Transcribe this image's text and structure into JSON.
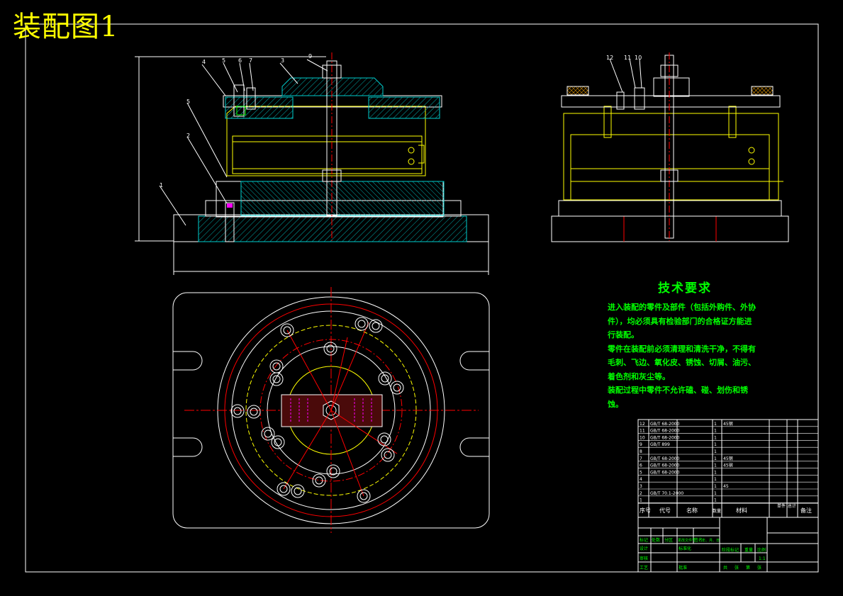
{
  "title": "装配图1",
  "tech_requirements": {
    "heading": "技术要求",
    "items": [
      "进入装配的零件及部件（包括外购件、外协件），均必须具有检验部门的合格证方能进行装配。",
      "零件在装配前必须清理和清洗干净，不得有毛刺、飞边、氧化皮、锈蚀、切屑、油污、着色剂和灰尘等。",
      "装配过程中零件不允许磕、碰、划伤和锈蚀。"
    ]
  },
  "balloons": [
    "1",
    "2",
    "3",
    "4",
    "5",
    "6",
    "7",
    "8",
    "9",
    "10",
    "11",
    "12"
  ],
  "parts_table": {
    "headers": [
      "序号",
      "代号",
      "名称",
      "数量",
      "材料",
      "单件",
      "总计",
      "备注"
    ],
    "rows": [
      [
        "12",
        "GB/T 68-2000",
        "",
        "1",
        "45钢"
      ],
      [
        "11",
        "GB/T 68-2000",
        "",
        "1",
        ""
      ],
      [
        "10",
        "GB/T 68-2000",
        "",
        "1",
        ""
      ],
      [
        "9",
        "GB/T 899",
        "",
        "1",
        ""
      ],
      [
        "8",
        "",
        "",
        "1",
        ""
      ],
      [
        "7",
        "GB/T 68-2000",
        "",
        "1",
        "45钢"
      ],
      [
        "6",
        "GB/T 68-2000",
        "",
        "1",
        "45钢"
      ],
      [
        "5",
        "GB/T 68-2000",
        "",
        "1",
        ""
      ],
      [
        "4",
        "",
        "",
        "1",
        ""
      ],
      [
        "3",
        "",
        "",
        "1",
        "45"
      ],
      [
        "2",
        "GB/T 70.1-2000",
        "",
        "1",
        ""
      ],
      [
        "1",
        "",
        "",
        "1",
        ""
      ]
    ]
  },
  "title_block": {
    "labels": [
      "标记",
      "处数",
      "分区",
      "更改文件号",
      "签名",
      "年、月、日",
      "设计",
      "标准化",
      "阶段标记",
      "重量",
      "比例",
      "审核",
      "工艺",
      "批准",
      "共",
      "张",
      "第",
      "张"
    ],
    "scale": "1:1"
  },
  "colors": {
    "yellow": "#ffff00",
    "cyan": "#00ffff",
    "red": "#ff0000",
    "green": "#00ff00",
    "white": "#ffffff",
    "hatch": "#00cccc",
    "magenta": "#ff00ff"
  }
}
